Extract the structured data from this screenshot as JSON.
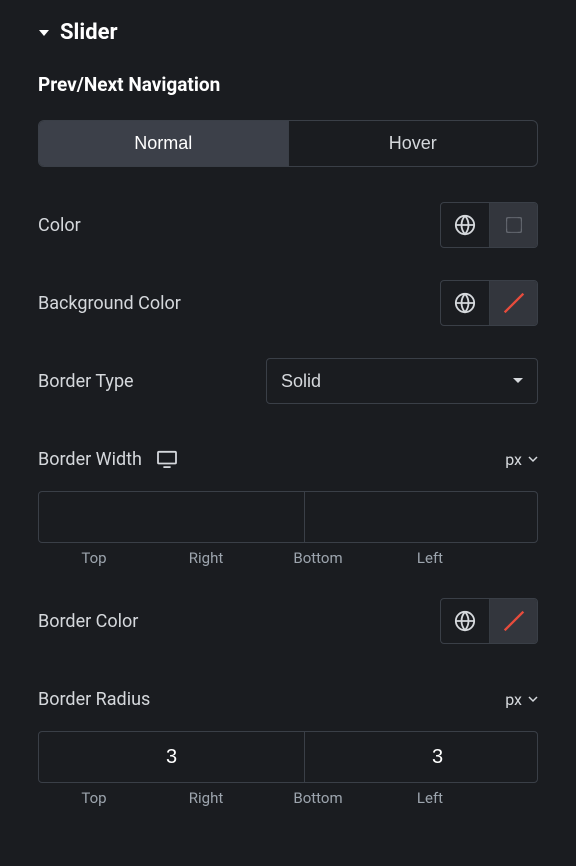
{
  "section": {
    "title": "Slider"
  },
  "subsection": {
    "title": "Prev/Next Navigation"
  },
  "tabs": {
    "normal": "Normal",
    "hover": "Hover"
  },
  "controls": {
    "color_label": "Color",
    "bg_label": "Background Color",
    "border_type_label": "Border Type",
    "border_type_value": "Solid",
    "border_width_label": "Border Width",
    "border_color_label": "Border Color",
    "border_radius_label": "Border Radius"
  },
  "units": {
    "border_width": "px",
    "border_radius": "px"
  },
  "border_width": {
    "top": "",
    "right": "",
    "bottom": "",
    "left": ""
  },
  "border_radius": {
    "top": "3",
    "right": "3",
    "bottom": "3",
    "left": "3"
  },
  "dim_labels": {
    "top": "Top",
    "right": "Right",
    "bottom": "Bottom",
    "left": "Left"
  }
}
